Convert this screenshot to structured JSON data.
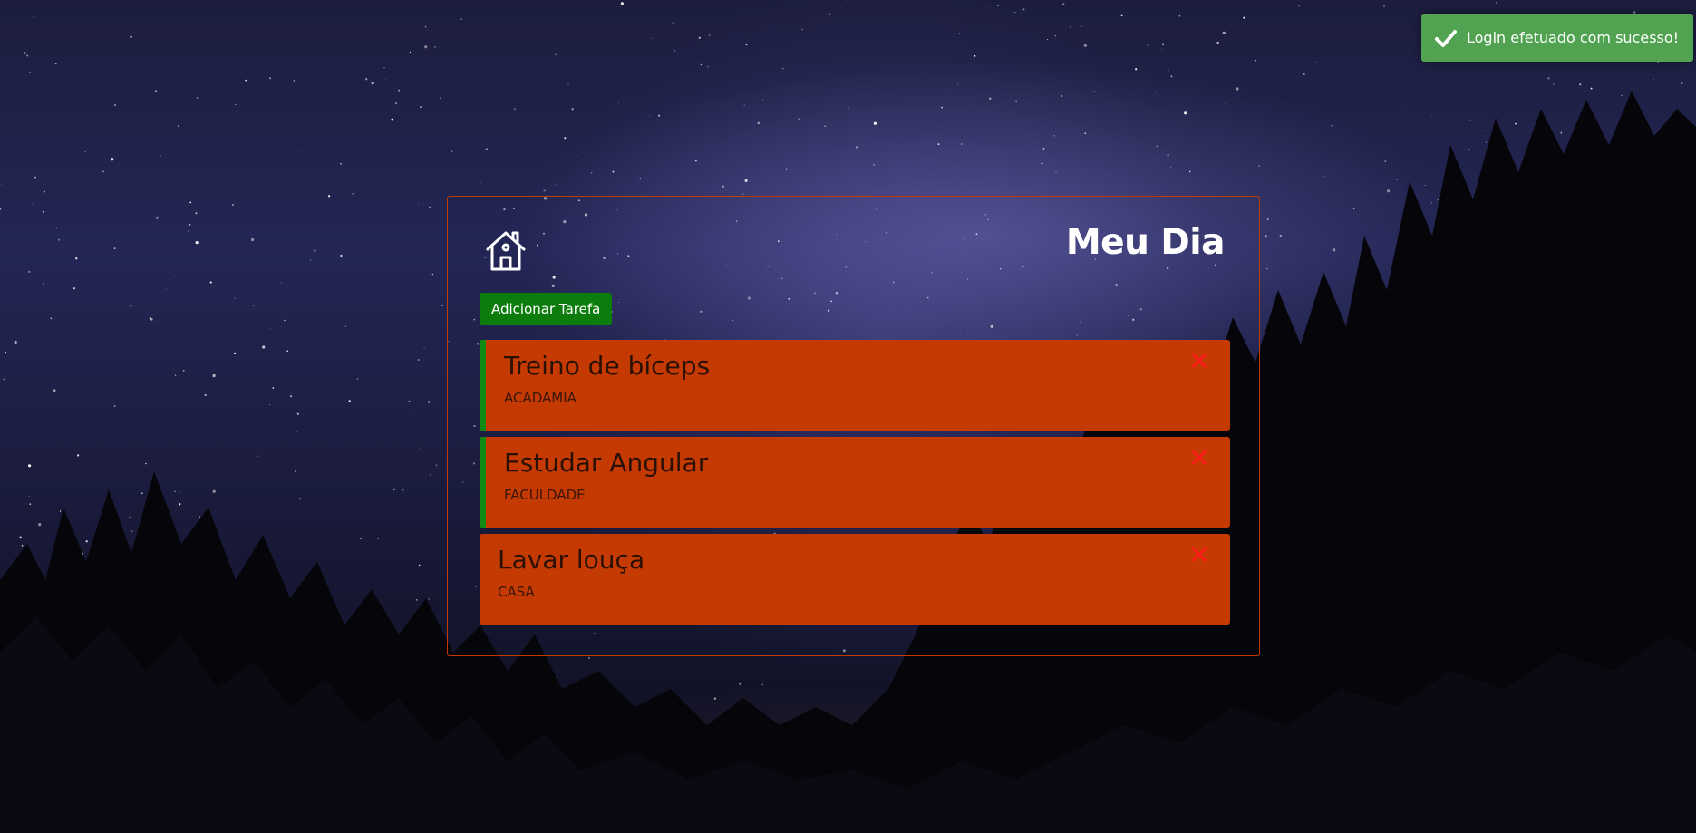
{
  "background": {
    "description_icon": "starry-night-sky"
  },
  "header": {
    "home_icon": "home-icon",
    "title": "Meu Dia"
  },
  "toolbar": {
    "add_task_label": "Adicionar Tarefa"
  },
  "tasks": [
    {
      "title": "Treino de bíceps",
      "category": "ACADAMIA",
      "completed": true,
      "delete_icon": "close-icon"
    },
    {
      "title": "Estudar Angular",
      "category": "FACULDADE",
      "completed": true,
      "delete_icon": "close-icon"
    },
    {
      "title": "Lavar louça",
      "category": "CASA",
      "completed": false,
      "delete_icon": "close-icon"
    }
  ],
  "toast": {
    "icon": "checkmark-icon",
    "message": "Login efetuado com sucesso!"
  },
  "colors": {
    "panel_border": "#c23a00",
    "task_background": "#c43a02",
    "task_completed_marker": "#138a13",
    "add_button": "#0c7d0c",
    "delete_icon": "#ff1a1a",
    "toast_background": "#51a351"
  }
}
